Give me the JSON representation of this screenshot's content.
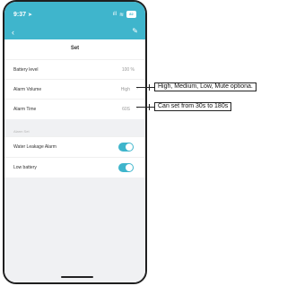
{
  "status_bar": {
    "time": "9:37",
    "location_glyph": "➤",
    "signal": "ıll",
    "wifi": "≋",
    "battery": "82"
  },
  "nav": {
    "back_glyph": "‹",
    "edit_glyph": "✎"
  },
  "header": {
    "title": "Set"
  },
  "rows": {
    "battery_level": {
      "label": "Battery level",
      "value": "100 %"
    },
    "alarm_volume": {
      "label": "Alarm Volume",
      "value": "High",
      "chevron": "›"
    },
    "alarm_time": {
      "label": "Alarm Time",
      "value": "60S",
      "chevron": "›"
    }
  },
  "alarm_set_section": {
    "label": "Alarm Set"
  },
  "toggles": {
    "water_leakage": {
      "label": "Water Leakage Alarm",
      "state": "on"
    },
    "low_battery": {
      "label": "Low battery",
      "state": "on"
    }
  },
  "callouts": {
    "volume_note": "High, Medium, Low, Mute optiona.",
    "time_note": "Can set from 30s to 180s"
  },
  "colors": {
    "accent": "#3fb5cc",
    "background": "#f0f1f3"
  }
}
